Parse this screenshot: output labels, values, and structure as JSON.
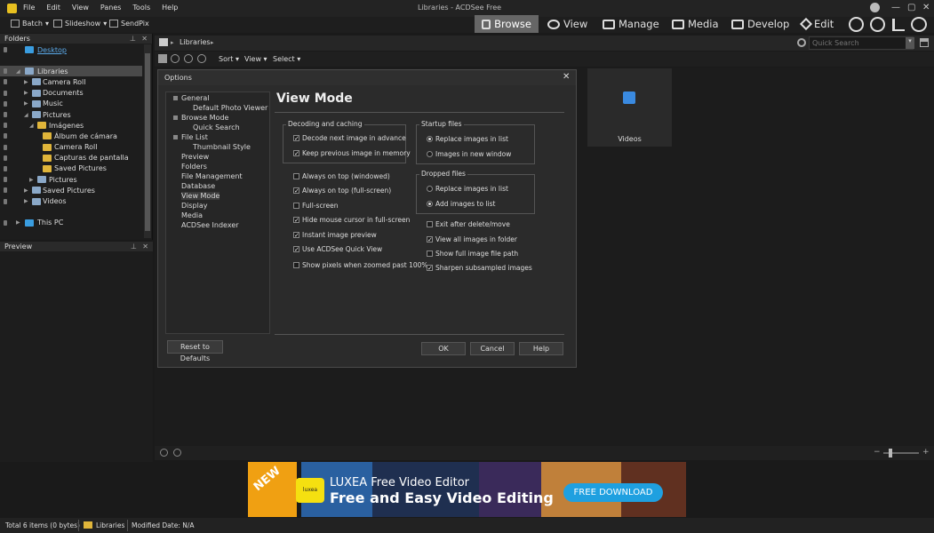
{
  "titlebar": {
    "menu": [
      "File",
      "Edit",
      "View",
      "Panes",
      "Tools",
      "Help"
    ],
    "title": "Libraries - ACDSee Free",
    "min": "—",
    "max": "▢",
    "close": "✕"
  },
  "toolbar2": {
    "batch": "Batch",
    "slideshow": "Slideshow",
    "sendpix": "SendPix"
  },
  "modes": {
    "browse": "Browse",
    "view": "View",
    "manage": "Manage",
    "media": "Media",
    "develop": "Develop",
    "edit": "Edit"
  },
  "folders": {
    "header": "Folders",
    "items": [
      {
        "label": "Desktop"
      },
      {
        "label": "Libraries"
      },
      {
        "label": "Camera Roll"
      },
      {
        "label": "Documents"
      },
      {
        "label": "Music"
      },
      {
        "label": "Pictures"
      },
      {
        "label": "Imágenes"
      },
      {
        "label": "Álbum de cámara"
      },
      {
        "label": "Camera Roll"
      },
      {
        "label": "Capturas de pantalla"
      },
      {
        "label": "Saved Pictures"
      },
      {
        "label": "Pictures"
      },
      {
        "label": "Saved Pictures"
      },
      {
        "label": "Videos"
      },
      {
        "label": "This PC"
      }
    ]
  },
  "preview": {
    "header": "Preview"
  },
  "path": {
    "crumb": "Libraries",
    "search_placeholder": "Quick Search"
  },
  "viewbar": {
    "sort": "Sort",
    "view": "View",
    "select": "Select"
  },
  "videos_tile": {
    "label": "Videos"
  },
  "dialog": {
    "title": "Options",
    "nav": [
      "General",
      "Default Photo Viewer",
      "Browse Mode",
      "Quick Search",
      "File List",
      "Thumbnail Style",
      "Preview",
      "Folders",
      "File Management",
      "Database",
      "View Mode",
      "Display",
      "Media",
      "ACDSee Indexer"
    ],
    "section": "View Mode",
    "decoding": {
      "caption": "Decoding and caching",
      "decode": "Decode next image in advance",
      "keep": "Keep previous image in memory"
    },
    "opts": [
      "Always on top (windowed)",
      "Always on top (full-screen)",
      "Full-screen",
      "Hide mouse cursor in full-screen",
      "Instant image preview",
      "Use ACDSee Quick View",
      "Show pixels when zoomed past 100%"
    ],
    "startup": {
      "caption": "Startup files",
      "replace": "Replace images in list",
      "newwin": "Images in new window"
    },
    "dropped": {
      "caption": "Dropped files",
      "replace": "Replace images in list",
      "add": "Add images to list"
    },
    "right_opts": [
      "Exit after delete/move",
      "View all images in folder",
      "Show full image file path",
      "Sharpen subsampled images"
    ],
    "reset": "Reset to Defaults",
    "ok": "OK",
    "cancel": "Cancel",
    "help": "Help"
  },
  "ad": {
    "new": "NEW",
    "logo": "luxea",
    "line1": "LUXEA Free Video Editor",
    "line2": "Free and Easy Video Editing",
    "cta": "FREE DOWNLOAD"
  },
  "status": {
    "total": "Total 6 items  (0 bytes)",
    "lib": "Libraries",
    "mod": "Modified Date: N/A"
  }
}
